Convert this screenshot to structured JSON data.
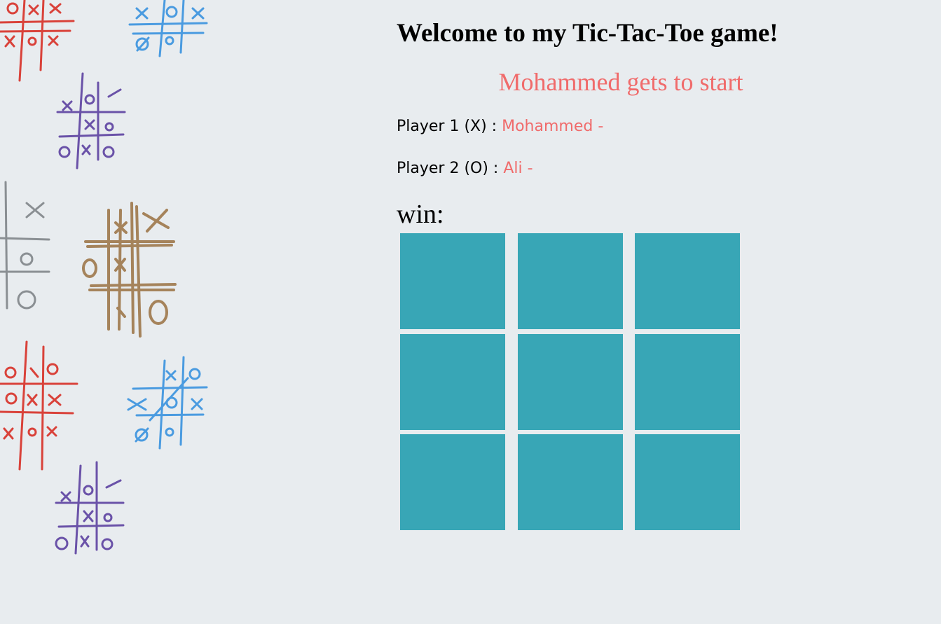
{
  "header": {
    "title": "Welcome to my Tic-Tac-Toe game!",
    "turn_message": "Mohammed gets to start"
  },
  "players": {
    "player1": {
      "label": "Player 1 (X) : ",
      "name": "Mohammed -"
    },
    "player2": {
      "label": "Player 2 (O) : ",
      "name": "Ali -"
    }
  },
  "result": {
    "win_label": "win:"
  },
  "board": {
    "cells": [
      "",
      "",
      "",
      "",
      "",
      "",
      "",
      "",
      ""
    ]
  },
  "colors": {
    "background": "#e8ecef",
    "cell": "#38a6b6",
    "accent_text": "#f06b6b"
  }
}
